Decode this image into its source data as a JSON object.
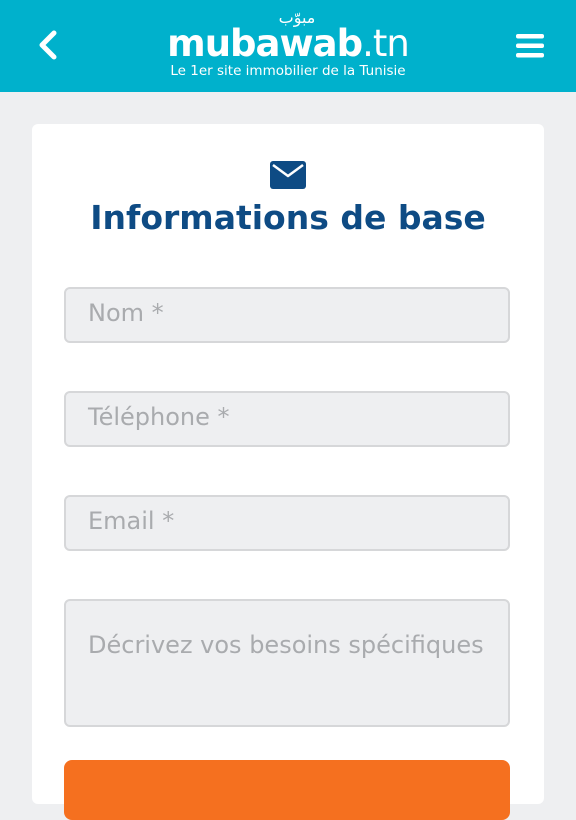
{
  "header": {
    "logo_arabic": "مبوّب",
    "logo_main": "mubawab",
    "logo_suffix": ".tn",
    "tagline": "Le 1er site immobilier de la Tunisie",
    "back_icon": "chevron-left-icon",
    "menu_icon": "hamburger-menu-icon",
    "background_color": "#00b1cc"
  },
  "form": {
    "icon": "envelope-icon",
    "title": "Informations de base",
    "title_color": "#0e4b84",
    "fields": {
      "name_placeholder": "Nom *",
      "phone_placeholder": "Téléphone *",
      "email_placeholder": "Email *",
      "needs_placeholder": "Décrivez vos besoins spécifiques"
    },
    "submit_color": "#f5701f"
  }
}
